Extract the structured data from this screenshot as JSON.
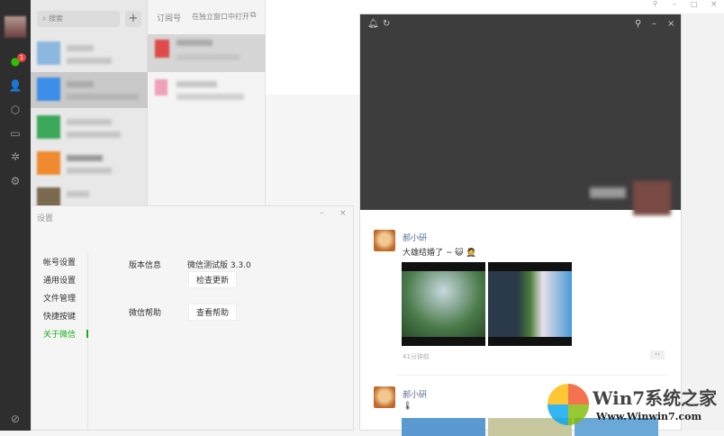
{
  "sidebar": {
    "badge": "1",
    "items": [
      "avatar",
      "chat-icon",
      "contacts-icon",
      "favorites-icon",
      "files-icon",
      "moments-icon",
      "mini-programs-icon",
      "settings-icon"
    ]
  },
  "chatlist": {
    "search_placeholder": "搜索",
    "add": "+"
  },
  "subscriptions": {
    "title": "订阅号",
    "open_window": "在独立窗口中打开"
  },
  "main": {
    "more": "···"
  },
  "window_controls": {
    "pin": "⚲",
    "min": "–",
    "max": "□",
    "close": "×"
  },
  "settings": {
    "title": "设置",
    "nav": [
      "帐号设置",
      "通用设置",
      "文件管理",
      "快捷按键",
      "关于微信"
    ],
    "version_label": "版本信息",
    "version_value": "微信测试版 3.3.0",
    "check_update": "检查更新",
    "help_label": "微信帮助",
    "view_help": "查看帮助",
    "accent": "#1aad19"
  },
  "moments": {
    "posts": [
      {
        "name": "郝小研",
        "text": "大雄结婚了 ~ 😺 🤵",
        "time": "41分钟前",
        "more": "··"
      },
      {
        "name": "郝小研",
        "text": "🌡"
      }
    ]
  },
  "watermark": {
    "brand": "Win7系统之家",
    "url": "Www.Winwin7.com"
  }
}
